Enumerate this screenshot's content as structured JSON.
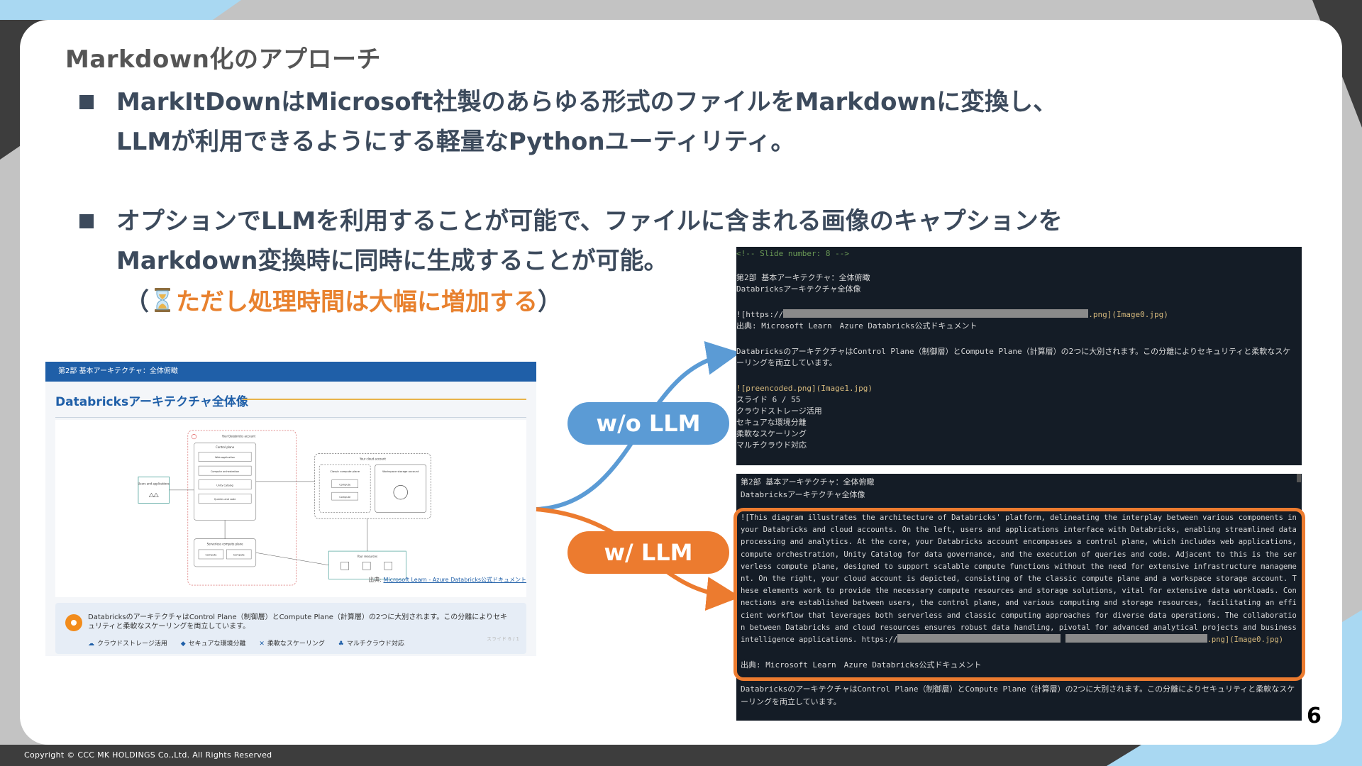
{
  "slide": {
    "title": "Markdown化のアプローチ",
    "bullet1_line1": "MarkItDownはMicrosoft社製のあらゆる形式のファイルをMarkdownに変換し、",
    "bullet1_line2": "LLMが利用できるようにする軽量なPythonユーティリティ。",
    "bullet2_line1": "オプションでLLMを利用することが可能で、ファイルに含まれる画像のキャプションを",
    "bullet2_line2": "Markdown変換時に同時に生成することが可能。",
    "note_open": "（",
    "note_highlight": "ただし処理時間は大幅に増加する",
    "note_close": "）",
    "page_number": "6",
    "copyright": "Copyright © CCC MK HOLDINGS Co.,Ltd. All Rights Reserved"
  },
  "labels": {
    "without_llm": "w/o LLM",
    "with_llm": "w/ LLM"
  },
  "screenshot": {
    "header": "第2部 基本アーキテクチャ：全体俯瞰",
    "title": "Databricksアーキテクチャ全体像",
    "source_prefix": "出典: ",
    "source_link": "Microsoft Learn - Azure Databricks公式ドキュメント",
    "diagram": {
      "account": "Your Databricks account",
      "control_plane": "Control plane",
      "web_app": "Web application",
      "compute_orch": "Compute orchestration",
      "unity": "Unity Catalog",
      "queries": "Queries and code",
      "serverless": "Serverless compute plane",
      "compute1": "Compute",
      "compute2": "Compute",
      "cloud_account": "Your cloud account",
      "classic": "Classic compute plane",
      "classic_compute1": "Compute",
      "classic_compute2": "Compute",
      "workspace": "Workspace storage account",
      "users": "Users and applications",
      "resources": "Your resources"
    },
    "info_text": "DatabricksのアーキテクチャはControl Plane（制御層）とCompute Plane（計算層）の2つに大別されます。この分離によりセキュリティと柔軟なスケーリングを両立しています。",
    "tags": [
      "クラウドストレージ活用",
      "セキュアな環境分離",
      "柔軟なスケーリング",
      "マルチクラウド対応"
    ],
    "page_label": "スライド 6 / 1"
  },
  "terminal_without": {
    "comment": "<!-- Slide number: 8 -->",
    "h1": "第2部 基本アーキテクチャ：全体俯瞰",
    "h2": "Databricksアーキテクチャ全体像",
    "img_prefix": "![https://",
    "img_suffix": ".png](Image0.jpg)",
    "source": "出典: Microsoft Learn　Azure Databricks公式ドキュメント",
    "desc1": "DatabricksのアーキテクチャはControl Plane（制御層）とCompute Plane（計算層）の2つに大別されます。この分離によりセキュリティと柔軟なスケ",
    "desc2": "ーリングを両立しています。",
    "img2": "![preencoded.png](Image1.jpg)",
    "slide_label": "スライド 6 / 55",
    "tag1": "クラウドストレージ活用",
    "tag2": "セキュアな環境分離",
    "tag3": "柔軟なスケーリング",
    "tag4": "マルチクラウド対応"
  },
  "terminal_with": {
    "h1": "第2部 基本アーキテクチャ：全体俯瞰",
    "h2": "Databricksアーキテクチャ全体像",
    "caption": "![This diagram illustrates the architecture of Databricks' platform, delineating the interplay between various components in your Databricks and cloud accounts. On the left, users and applications interface with Databricks, enabling streamlined data processing and analytics. At the core, your Databricks account encompasses a control plane, which includes web applications, compute orchestration, Unity Catalog for data governance, and the execution of queries and code. Adjacent to this is the serverless compute plane, designed to support scalable compute functions without the need for extensive infrastructure management. On the right, your cloud account is depicted, consisting of the classic compute plane and a workspace storage account. These elements work to provide the necessary compute resources and storage solutions, vital for extensive data workloads. Connections are established between users, the control plane, and various computing and storage resources, facilitating an efficient workflow that leverages both serverless and classic computing approaches for diverse data operations. The collaboration between Databricks and cloud resources ensures robust data handling, pivotal for advanced analytical projects and business intelligence applications. https://",
    "img_suffix": ".png](Image0.jpg)",
    "source": "出典: Microsoft Learn　Azure Databricks公式ドキュメント",
    "desc1": "DatabricksのアーキテクチャはControl Plane（制御層）とCompute Plane（計算層）の2つに大別されます。この分離によりセキュリティと柔軟なスケ",
    "desc2": "ーリングを両立しています。"
  },
  "colors": {
    "accent_orange": "#ec7b2f",
    "accent_blue": "#5b9bd5",
    "text_dark": "#3c4a5c",
    "terminal_bg": "#141c26"
  }
}
